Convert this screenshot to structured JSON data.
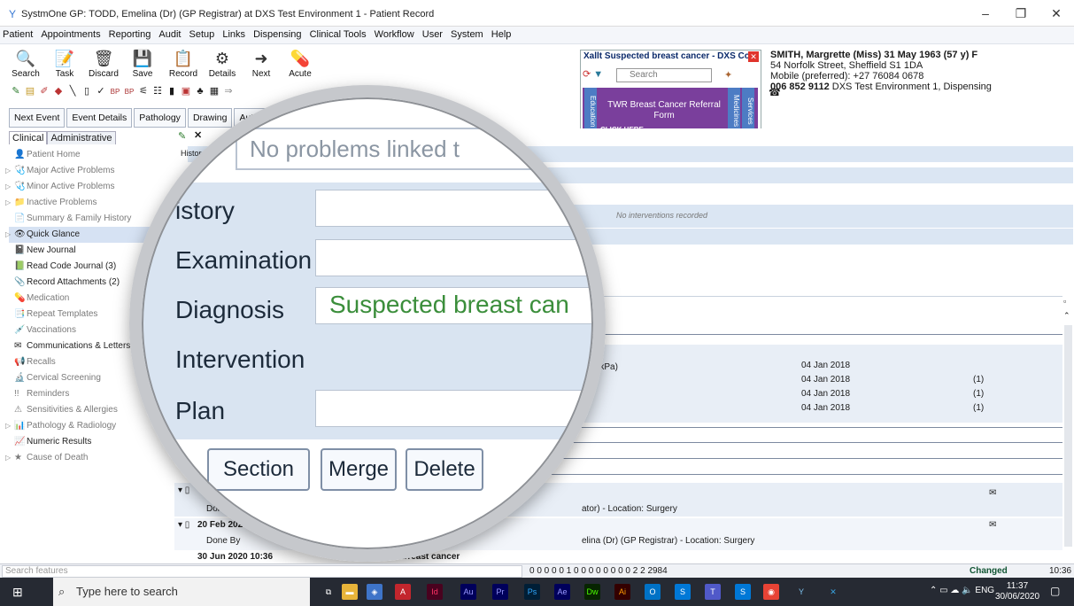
{
  "window": {
    "title": "SystmOne GP: TODD, Emelina (Dr) (GP Registrar) at DXS Test Environment 1 - Patient Record",
    "minimize": "–",
    "restore": "❐",
    "close": "✕"
  },
  "menu": [
    "Patient",
    "Appointments",
    "Reporting",
    "Audit",
    "Setup",
    "Links",
    "Dispensing",
    "Clinical Tools",
    "Workflow",
    "User",
    "System",
    "Help"
  ],
  "toolbar": {
    "buttons": [
      {
        "label": "Search",
        "icon": "🔍"
      },
      {
        "label": "Task",
        "icon": "📝"
      },
      {
        "label": "Discard",
        "icon": "🗑"
      },
      {
        "label": "Save",
        "icon": "💾"
      },
      {
        "label": "Record",
        "icon": "📋"
      },
      {
        "label": "Details",
        "icon": "⚙"
      },
      {
        "label": "Next",
        "icon": "➜"
      },
      {
        "label": "Acute",
        "icon": "💊"
      }
    ],
    "nav_buttons": [
      "Next Event",
      "Event Details",
      "Pathology",
      "Drawing",
      "Auto-Co"
    ]
  },
  "dxs_panel": {
    "header": "Xallt Suspected breast cancer - DXS Cor",
    "search_placeholder": "Search",
    "side_left": "Education",
    "side_right1": "Medicines",
    "side_right2": "Services",
    "banner_text": "TWR Breast Cancer Referral Form",
    "click_here": "CLICK HERE"
  },
  "patient": {
    "name": "SMITH, Margrette (Miss) 31 May 1963 (57 y) F",
    "address": "54 Norfolk Street, Sheffield S1 1DA",
    "mobile": "Mobile (preferred): +27 76084 0678",
    "nhs_number": "006 852 9112",
    "location": "DXS Test Environment 1, Dispensing"
  },
  "sidebar": {
    "tabs": [
      "Clinical",
      "Administrative"
    ],
    "items": [
      {
        "label": "Patient Home",
        "muted": true,
        "icon": "👤"
      },
      {
        "label": "Major Active Problems",
        "muted": true,
        "icon": "🩺"
      },
      {
        "label": "Minor Active Problems",
        "muted": true,
        "icon": "🩺"
      },
      {
        "label": "Inactive Problems",
        "muted": true,
        "icon": "📁"
      },
      {
        "label": "Summary & Family History",
        "muted": true,
        "icon": "📄"
      },
      {
        "label": "Quick Glance",
        "muted": false,
        "icon": "👁"
      },
      {
        "label": "New Journal",
        "muted": false,
        "icon": "📓"
      },
      {
        "label": "Read Code Journal (3)",
        "muted": false,
        "icon": "📗"
      },
      {
        "label": "Record Attachments (2)",
        "muted": false,
        "icon": "📎"
      },
      {
        "label": "Medication",
        "muted": true,
        "icon": "💊"
      },
      {
        "label": "Repeat Templates",
        "muted": true,
        "icon": "📑"
      },
      {
        "label": "Vaccinations",
        "muted": true,
        "icon": "💉"
      },
      {
        "label": "Communications & Letters",
        "muted": false,
        "icon": "✉"
      },
      {
        "label": "Recalls",
        "muted": true,
        "icon": "📢"
      },
      {
        "label": "Cervical Screening",
        "muted": true,
        "icon": "🔬"
      },
      {
        "label": "Reminders",
        "muted": true,
        "icon": "!!"
      },
      {
        "label": "Sensitivities & Allergies",
        "muted": true,
        "icon": "⚠"
      },
      {
        "label": "Pathology & Radiology",
        "muted": true,
        "icon": "📊"
      },
      {
        "label": "Numeric Results",
        "muted": false,
        "icon": "📈"
      },
      {
        "label": "Cause of Death",
        "muted": true,
        "icon": "★"
      }
    ]
  },
  "content": {
    "history_label": "Histor",
    "no_interventions": "No interventions recorded",
    "reading_fragment": "3 kPa)",
    "dates": [
      "04 Jan 2018",
      "04 Jan 2018",
      "04 Jan 2018",
      "04 Jan 2018"
    ],
    "counts": [
      "(1)",
      "(1)",
      "(1)"
    ],
    "entry1_by": "Done",
    "entry1_detail": "ator) - Location: Surgery",
    "entry2_date": "20 Feb 202",
    "entry2_by": "Done By",
    "entry2_detail": "elina (Dr) (GP Registrar) - Location: Surgery",
    "entry3_date": "30 Jun 2020 10:36",
    "entry3_title": "Xallt Suspected breast cancer"
  },
  "magnifier": {
    "top_text": "No problems linked t",
    "labels": [
      "istory",
      "Examination",
      "Diagnosis",
      "Intervention",
      "Plan"
    ],
    "diagnosis_value": "Suspected breast can",
    "buttons": [
      "Section",
      "Merge",
      "Delete"
    ]
  },
  "statusbar": {
    "search_placeholder": "Search features",
    "counts": "0 0 0 0 0   1 0   0 0 0 0   0 0 0   2 2 2984",
    "changed": "Changed",
    "time": "10:36"
  },
  "taskbar": {
    "search_placeholder": "Type here to search",
    "lang": "ENG",
    "time": "11:37",
    "date": "30/06/2020"
  },
  "colors": {
    "accent_blue": "#dbe6f3",
    "diagnosis_green": "#3b8e3b",
    "banner_purple": "#7a3f9c",
    "taskbar": "#262a33"
  }
}
